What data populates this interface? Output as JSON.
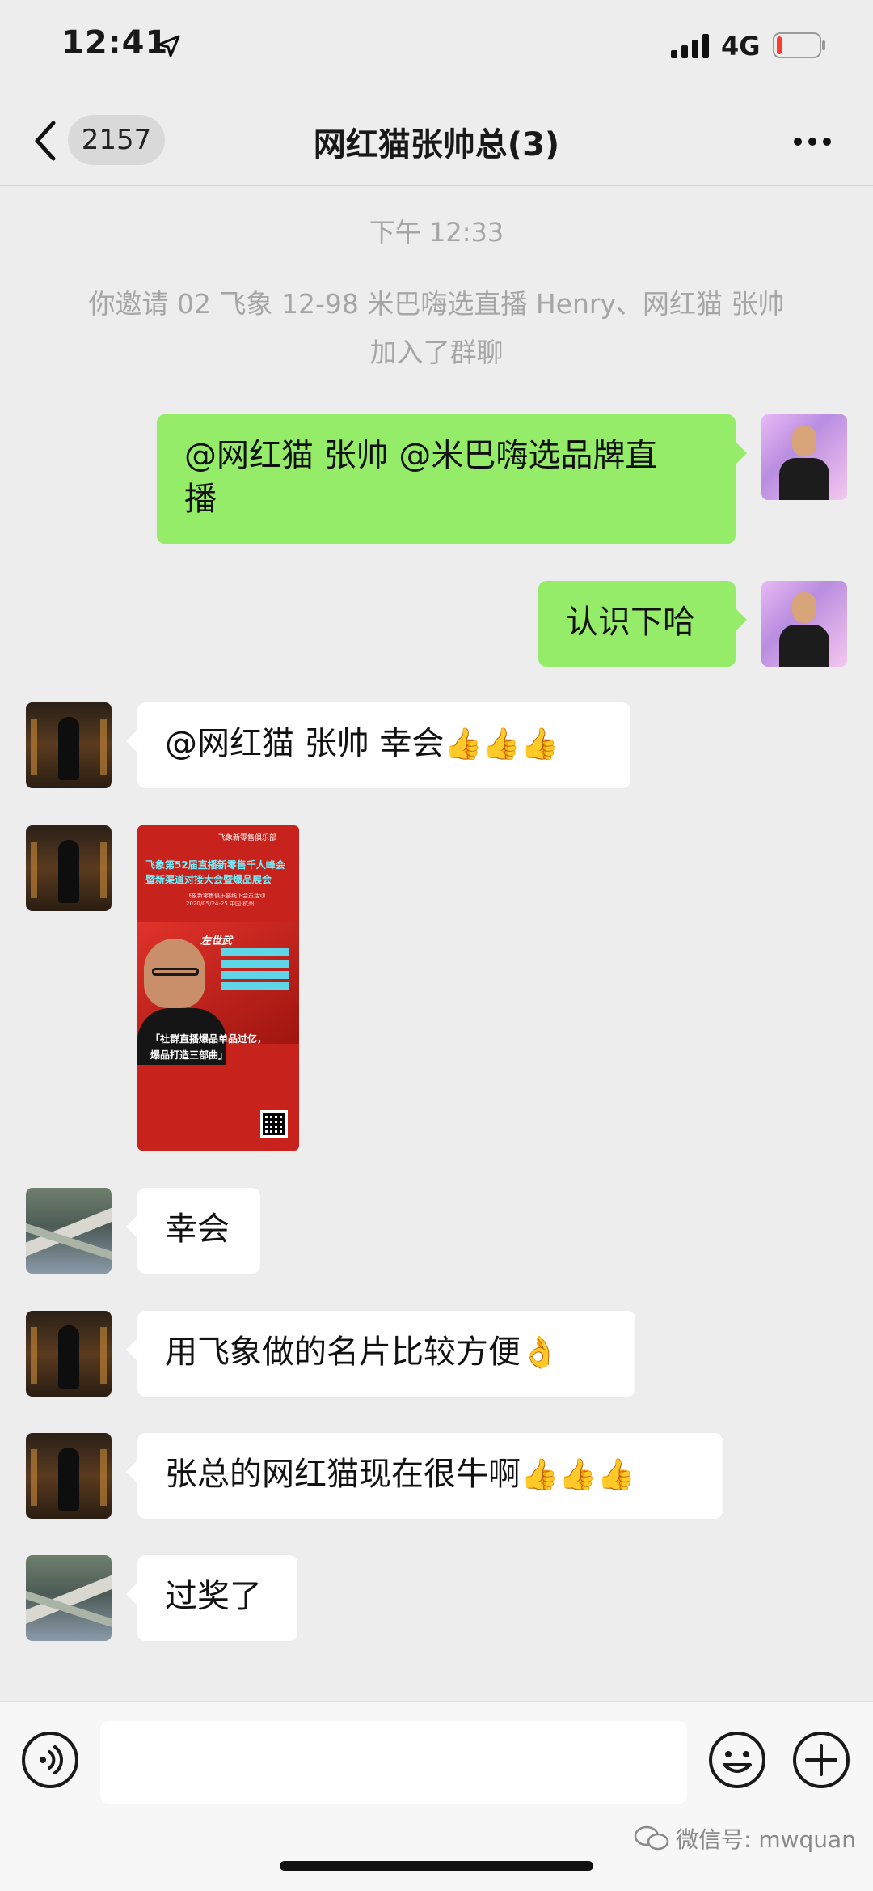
{
  "status_bar": {
    "time": "12:41",
    "network": "4G",
    "icons": [
      "location-arrow-icon",
      "signal-icon",
      "battery-low-icon"
    ]
  },
  "nav": {
    "unread_count": "2157",
    "title": "网红猫张帅总(3)",
    "icons": [
      "back-chevron-icon",
      "more-dots-icon"
    ]
  },
  "system": {
    "time": "下午 12:33",
    "notice_line1": "你邀请 02 飞象 12-98 米巴嗨选直播 Henry、网红猫 张帅",
    "notice_line2": "加入了群聊"
  },
  "messages": [
    {
      "side": "right",
      "text_line1": "@网红猫 张帅 @米巴嗨选品牌直",
      "text_line2": "播"
    },
    {
      "side": "right",
      "text": "认识下哈"
    },
    {
      "side": "left",
      "text": "@网红猫 张帅 幸会",
      "emoji": "👍👍👍"
    },
    {
      "side": "left",
      "type": "image",
      "poster": {
        "brand": "飞象新零售俱乐部",
        "headline_line1": "飞象第52届直播新零售千人峰会",
        "headline_line2": "暨新渠道对接大会暨爆品展会",
        "sub_line1": "飞象新零售俱乐部线下会员活动",
        "sub_line2": "2020/05/24-25    中国·杭州",
        "name": "左世武",
        "quote_line1": "「社群直播爆品单品过亿，",
        "quote_line2": "爆品打造三部曲」"
      }
    },
    {
      "side": "left",
      "text": "幸会"
    },
    {
      "side": "left",
      "text": "用飞象做的名片比较方便",
      "emoji": "👌"
    },
    {
      "side": "left",
      "text": "张总的网红猫现在很牛啊",
      "emoji": "👍👍👍"
    },
    {
      "side": "left",
      "text": "过奖了"
    }
  ],
  "input_bar": {
    "placeholder": "",
    "icons": [
      "voice-icon",
      "emoji-face-icon",
      "plus-icon"
    ]
  },
  "watermark": {
    "text": "微信号: mwquan"
  },
  "colors": {
    "background": "#ededed",
    "my_bubble": "#95ec69",
    "their_bubble": "#ffffff",
    "system_text": "#a6a6a6"
  }
}
